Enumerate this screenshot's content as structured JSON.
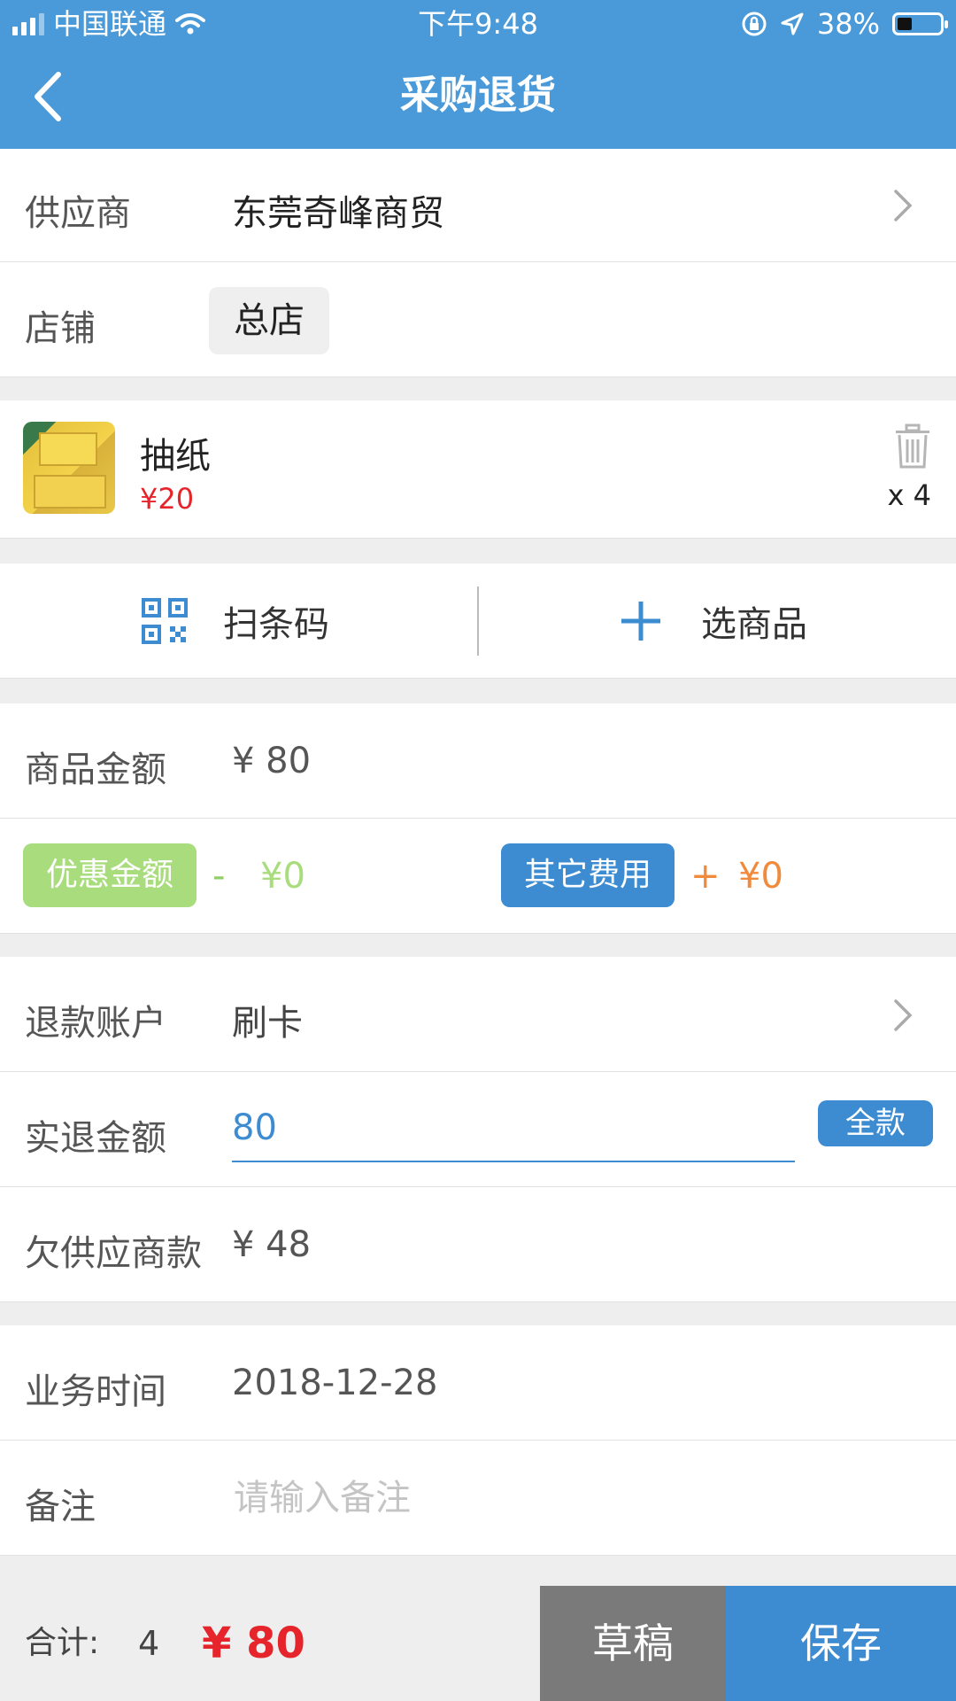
{
  "status_bar": {
    "carrier": "中国联通",
    "time": "下午9:48",
    "battery_percent": "38%",
    "battery_level": 0.38
  },
  "header": {
    "title": "采购退货"
  },
  "supplier": {
    "label": "供应商",
    "value": "东莞奇峰商贸"
  },
  "store": {
    "label": "店铺",
    "value": "总店"
  },
  "product": {
    "name": "抽纸",
    "price": "¥20",
    "quantity": "x 4"
  },
  "actions": {
    "scan_label": "扫条码",
    "select_label": "选商品"
  },
  "goods_amount": {
    "label": "商品金额",
    "value": "¥ 80"
  },
  "adjustments": {
    "discount_label": "优惠金额",
    "discount_sign": "-",
    "discount_value": "¥0",
    "fees_label": "其它费用",
    "fees_sign": "+",
    "fees_value": "¥0"
  },
  "refund_account": {
    "label": "退款账户",
    "value": "刷卡"
  },
  "actual_refund": {
    "label": "实退金额",
    "value": "80",
    "full_label": "全款"
  },
  "owed_supplier": {
    "label": "欠供应商款",
    "value": "¥ 48"
  },
  "business_time": {
    "label": "业务时间",
    "value": "2018-12-28"
  },
  "remark": {
    "label": "备注",
    "placeholder": "请输入备注"
  },
  "footer": {
    "total_label": "合计:",
    "total_count": "4",
    "total_amount": "¥ 80",
    "draft_label": "草稿",
    "save_label": "保存"
  },
  "colors": {
    "primary": "#4a9ad9",
    "accent_blue": "#3d8cd1",
    "discount_green": "#a8dc7c",
    "fee_orange": "#f08a3c",
    "price_red": "#e5252b"
  }
}
